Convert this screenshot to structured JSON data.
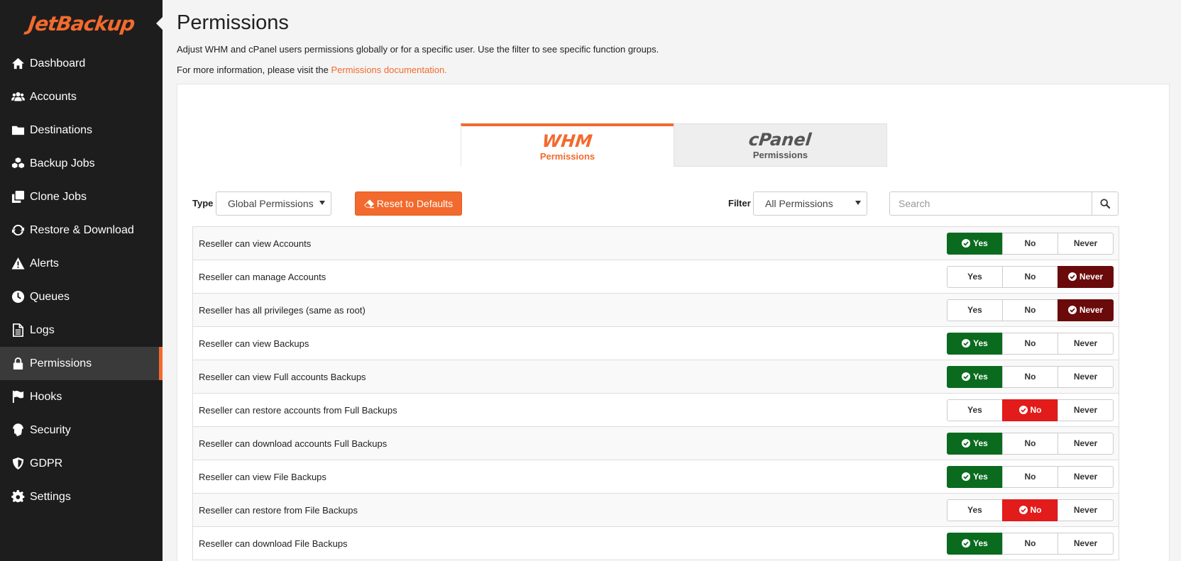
{
  "app": {
    "logo": "JetBackup"
  },
  "sidebar": {
    "items": [
      {
        "label": "Dashboard",
        "icon": "home-icon"
      },
      {
        "label": "Accounts",
        "icon": "users-icon"
      },
      {
        "label": "Destinations",
        "icon": "folder-icon"
      },
      {
        "label": "Backup Jobs",
        "icon": "cubes-icon"
      },
      {
        "label": "Clone Jobs",
        "icon": "clone-icon"
      },
      {
        "label": "Restore & Download",
        "icon": "refresh-icon"
      },
      {
        "label": "Alerts",
        "icon": "warning-icon"
      },
      {
        "label": "Queues",
        "icon": "clock-icon"
      },
      {
        "label": "Logs",
        "icon": "file-icon"
      },
      {
        "label": "Permissions",
        "icon": "lock-icon",
        "active": true
      },
      {
        "label": "Hooks",
        "icon": "flag-icon"
      },
      {
        "label": "Security",
        "icon": "fingerprint-icon"
      },
      {
        "label": "GDPR",
        "icon": "shield-icon"
      },
      {
        "label": "Settings",
        "icon": "gear-icon"
      }
    ]
  },
  "header": {
    "title": "Permissions",
    "description": "Adjust WHM and cPanel users permissions globally or for a specific user. Use the filter to see specific function groups.",
    "more_prefix": "For more information, please visit the ",
    "more_link": "Permissions documentation."
  },
  "tabs": [
    {
      "logo": "WHM",
      "label": "Permissions",
      "active": true
    },
    {
      "logo": "cPanel",
      "label": "Permissions",
      "active": false
    }
  ],
  "toolbar": {
    "type_label": "Type",
    "type_value": "Global Permissions",
    "reset_label": "Reset to Defaults",
    "filter_label": "Filter",
    "filter_value": "All Permissions",
    "search_placeholder": "Search"
  },
  "options": [
    "Yes",
    "No",
    "Never"
  ],
  "colors": {
    "accent": "#f26a2e",
    "yes": "#0a6b1f",
    "no": "#e21b1b",
    "never": "#6a0a0a"
  },
  "permissions": [
    {
      "label": "Reseller can view Accounts",
      "value": "Yes"
    },
    {
      "label": "Reseller can manage Accounts",
      "value": "Never"
    },
    {
      "label": "Reseller has all privileges (same as root)",
      "value": "Never"
    },
    {
      "label": "Reseller can view Backups",
      "value": "Yes"
    },
    {
      "label": "Reseller can view Full accounts Backups",
      "value": "Yes"
    },
    {
      "label": "Reseller can restore accounts from Full Backups",
      "value": "No"
    },
    {
      "label": "Reseller can download accounts Full Backups",
      "value": "Yes"
    },
    {
      "label": "Reseller can view File Backups",
      "value": "Yes"
    },
    {
      "label": "Reseller can restore from File Backups",
      "value": "No"
    },
    {
      "label": "Reseller can download File Backups",
      "value": "Yes"
    }
  ]
}
